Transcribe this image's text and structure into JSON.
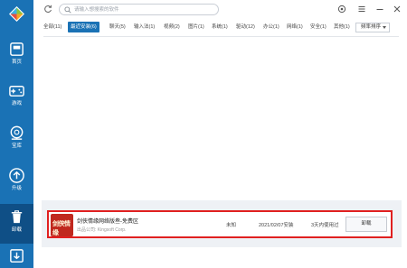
{
  "sidebar": {
    "items": [
      {
        "label": "首页",
        "icon": "home-icon"
      },
      {
        "label": "游戏",
        "icon": "gamepad-icon"
      },
      {
        "label": "宝库",
        "icon": "vault-icon"
      },
      {
        "label": "升级",
        "icon": "upgrade-icon"
      },
      {
        "label": "卸载",
        "icon": "trash-icon"
      },
      {
        "label": "",
        "icon": "download-icon"
      }
    ],
    "active_index": 4
  },
  "search": {
    "placeholder": "请输入想搜索的软件"
  },
  "tabs": [
    {
      "label": "全部(11)"
    },
    {
      "label": "最近安装(6)"
    },
    {
      "label": "聊天(5)"
    },
    {
      "label": "输入法(1)"
    },
    {
      "label": "视频(2)"
    },
    {
      "label": "图片(1)"
    },
    {
      "label": "系统(1)"
    },
    {
      "label": "驱动(12)"
    },
    {
      "label": "办公(1)"
    },
    {
      "label": "网络(1)"
    },
    {
      "label": "安全(1)"
    },
    {
      "label": "其他(1)"
    }
  ],
  "active_tab_index": 1,
  "sort": {
    "label": "频率排序"
  },
  "app_row": {
    "icon_text": "剑侠情缘",
    "name": "剑侠情缘网络版叁-免费区",
    "publisher": "出品公司: Kingsoft Corp.",
    "size": "未知",
    "install_date": "2021/02/07安装",
    "used": "3天内使用过",
    "action": "卸载"
  },
  "colors": {
    "sidebar": "#1a72b5",
    "sidebar_active": "#0f4f86",
    "highlight_border": "#e02020",
    "tab_active": "#1a72b5"
  }
}
